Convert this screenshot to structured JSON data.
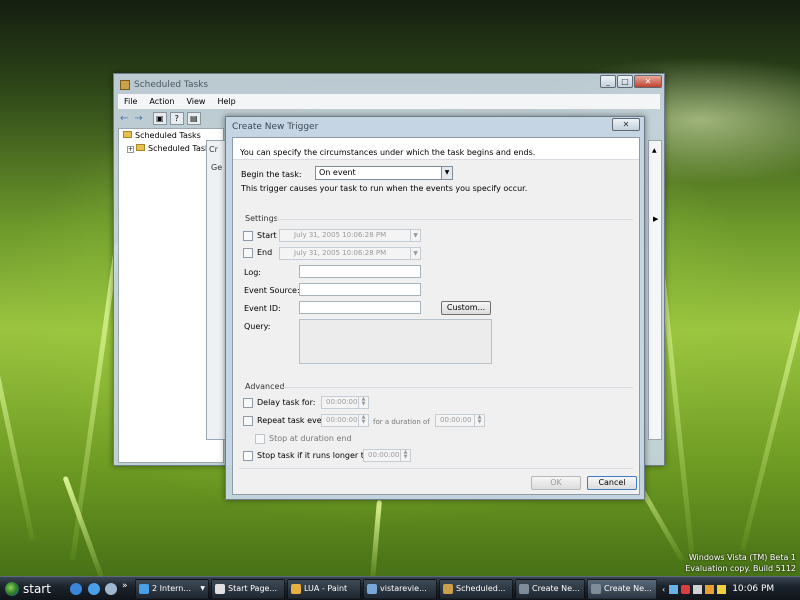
{
  "bg_window": {
    "title": "Scheduled Tasks",
    "menu": [
      "File",
      "Action",
      "View",
      "Help"
    ],
    "toolbar": {
      "back_icon": "←",
      "forward_icon": "→",
      "tools": [
        "▣",
        "?",
        "▤"
      ]
    },
    "tree": [
      {
        "label": "Scheduled Tasks"
      },
      {
        "label": "Scheduled Tasks"
      }
    ],
    "tab_stub": "Cr",
    "col_stub": "Ge",
    "controls": {
      "min": "_",
      "max": "□",
      "close": "✕"
    }
  },
  "dialog": {
    "title": "Create New Trigger",
    "close": "✕",
    "intro": "You can specify the circumstances under which the task begins and ends.",
    "begin_label": "Begin the task:",
    "begin_value": "On event",
    "dropdown_arrow": "▼",
    "hint": "This trigger causes your task to run when the events you specify occur.",
    "settings": {
      "title": "Settings",
      "start_label": "Start",
      "start_date": "July     31, 2005     10:06:28 PM",
      "end_label": "End",
      "end_date": "July     31, 2005     10:06:28 PM",
      "log_label": "Log:",
      "source_label": "Event Source:",
      "id_label": "Event ID:",
      "custom_button": "Custom...",
      "query_label": "Query:",
      "date_arrow": "▼"
    },
    "advanced": {
      "title": "Advanced",
      "delay_label": "Delay task for:",
      "delay_value": "00:00:00",
      "repeat_label": "Repeat task every",
      "repeat_value": "00:00:00",
      "duration_label": "for a duration of",
      "duration_value": "00:00:00",
      "stop_duration_label": "Stop at duration end",
      "stop_longer_label": "Stop task if it runs longer than",
      "stop_longer_value": "00:00:00"
    },
    "ok": "OK",
    "cancel": "Cancel"
  },
  "taskbar": {
    "start": "start",
    "tasks": [
      "2 Intern...",
      "Start Page...",
      "LUA - Paint",
      "vistarevie...",
      "Scheduled...",
      "Create Ne...",
      "Create Ne..."
    ],
    "clock": "10:06 PM",
    "ql_more": "»",
    "group_arrow": "▼"
  },
  "watermark": {
    "line1": "Windows Vista (TM) Beta 1",
    "line2": "Evaluation copy. Build 5112"
  },
  "colors": {
    "accent": "#3a74c7",
    "taskbar": "#1c232c"
  }
}
